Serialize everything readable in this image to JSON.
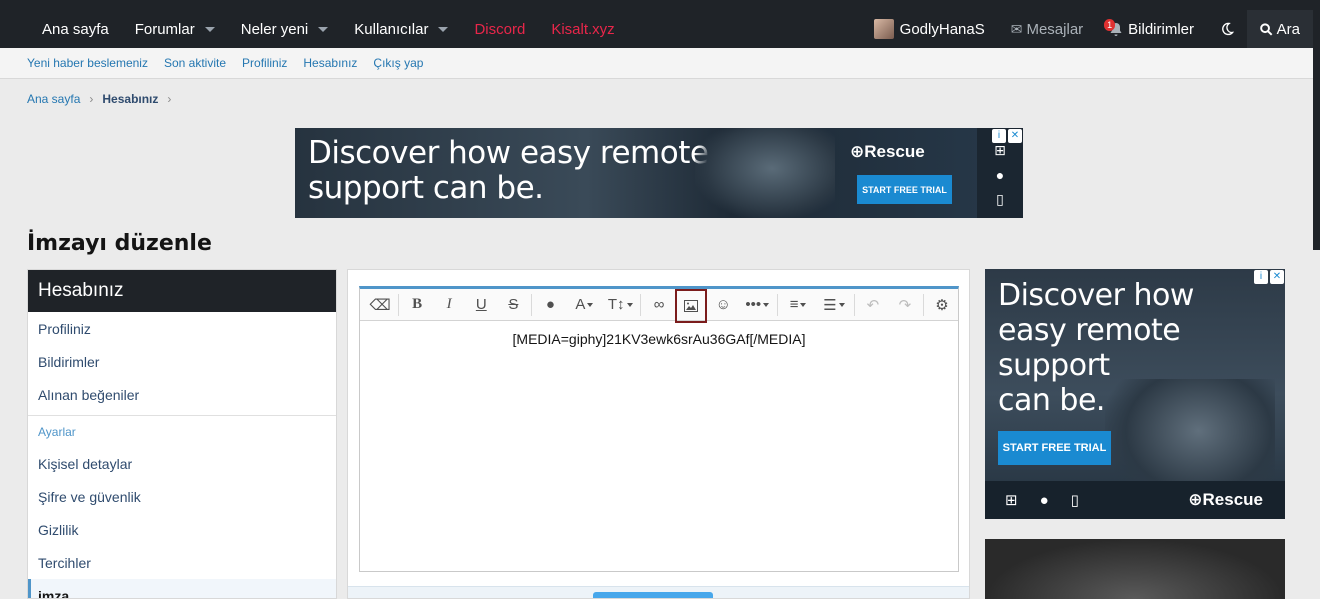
{
  "topnav": {
    "items": [
      {
        "label": "Ana sayfa",
        "dropdown": false,
        "color": "#ffffff"
      },
      {
        "label": "Forumlar",
        "dropdown": true,
        "color": "#ffffff"
      },
      {
        "label": "Neler yeni",
        "dropdown": true,
        "color": "#ffffff"
      },
      {
        "label": "Kullanıcılar",
        "dropdown": true,
        "color": "#ffffff"
      },
      {
        "label": "Discord",
        "dropdown": false,
        "color": "#e8264a"
      },
      {
        "label": "Kisalt.xyz",
        "dropdown": false,
        "color": "#e8264a"
      }
    ],
    "user": "GodlyHanaS",
    "messages": "Mesajlar",
    "notifications": "Bildirimler",
    "notification_count": "1",
    "search": "Ara"
  },
  "subnav": {
    "items": [
      "Yeni haber beslemeniz",
      "Son aktivite",
      "Profiliniz",
      "Hesabınız",
      "Çıkış yap"
    ]
  },
  "breadcrumb": {
    "home": "Ana sayfa",
    "current": "Hesabınız"
  },
  "ad_top": {
    "headline_line1": "Discover how easy remote",
    "headline_line2": "support can be.",
    "brand": "Rescue",
    "cta": "START FREE TRIAL"
  },
  "page": {
    "title": "İmzayı düzenle"
  },
  "sidebar": {
    "title": "Hesabınız",
    "items_top": [
      "Profiliniz",
      "Bildirimler",
      "Alınan beğeniler"
    ],
    "section": "Ayarlar",
    "items_settings": [
      "Kişisel detaylar",
      "Şifre ve güvenlik",
      "Gizlilik",
      "Tercihler"
    ],
    "active": "imza"
  },
  "editor": {
    "content": "[MEDIA=giphy]21KV3ewk6srAu36GAf[/MEDIA]",
    "selected_tool": "insert-image",
    "accent": "#4f95c9"
  },
  "ad_right": {
    "headline_line1": "Discover how",
    "headline_line2": "easy remote",
    "headline_line3": "support",
    "headline_line4": "can be.",
    "cta": "START FREE TRIAL",
    "brand": "Rescue"
  }
}
